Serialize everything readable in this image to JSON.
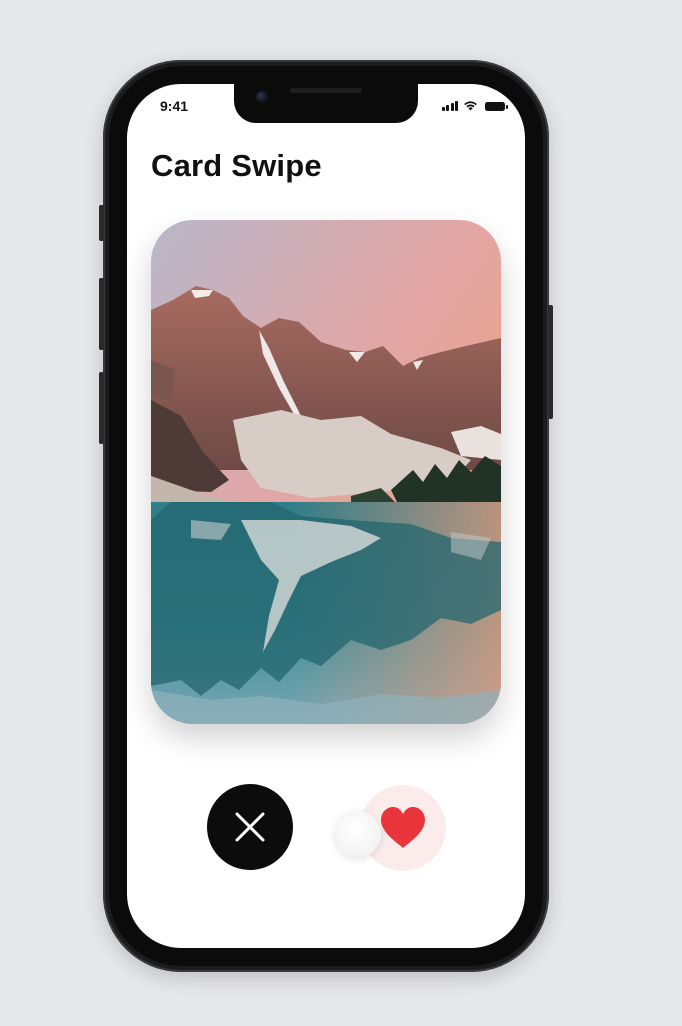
{
  "status_bar": {
    "time": "9:41",
    "icons": [
      "signal-icon",
      "wifi-icon",
      "battery-icon"
    ]
  },
  "header": {
    "title": "Card Swipe"
  },
  "card": {
    "image": "mountain-lake-landscape"
  },
  "actions": {
    "dislike_icon": "close-icon",
    "like_icon": "heart-icon"
  },
  "colors": {
    "background": "#e7e8ec",
    "dislike_button": "#0c0c0c",
    "heart": "#e8343a",
    "like_glow": "#fbeceb"
  }
}
